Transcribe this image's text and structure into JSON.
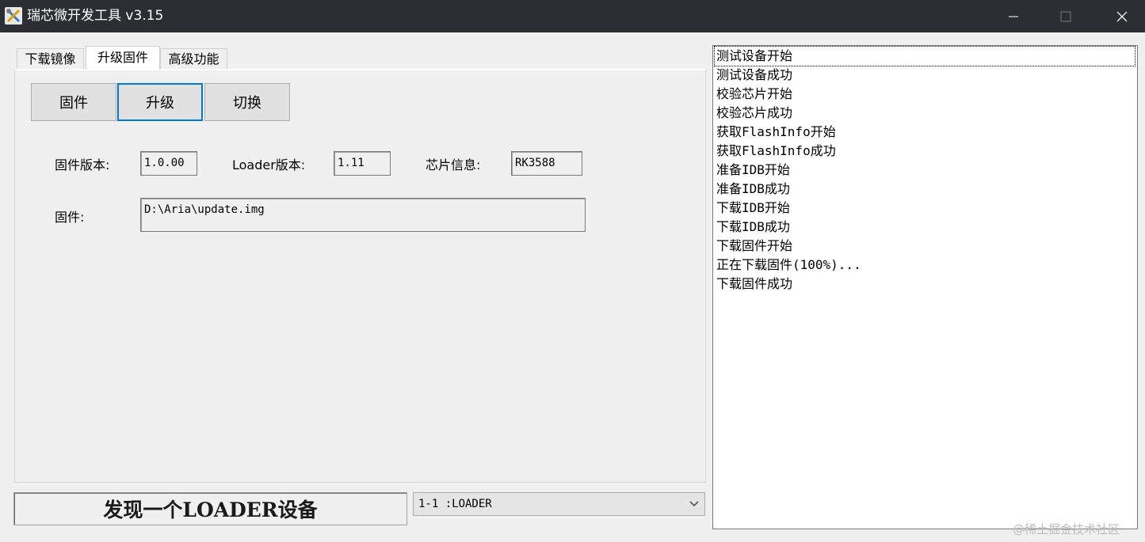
{
  "window": {
    "title": "瑞芯微开发工具 v3.15",
    "icons": {
      "app": "tools-icon",
      "minimize": "minimize-icon",
      "maximize": "maximize-icon",
      "close": "close-icon"
    }
  },
  "tabs": [
    {
      "label": "下载镜像",
      "active": false
    },
    {
      "label": "升级固件",
      "active": true
    },
    {
      "label": "高级功能",
      "active": false
    }
  ],
  "buttons": {
    "firmware": "固件",
    "upgrade": "升级",
    "switch": "切换"
  },
  "info": {
    "firmware_version_label": "固件版本:",
    "firmware_version_value": "1.0.00",
    "loader_version_label": "Loader版本:",
    "loader_version_value": "1.11",
    "chip_info_label": "芯片信息:",
    "chip_info_value": "RK3588",
    "firmware_path_label": "固件:",
    "firmware_path_value": "D:\\Aria\\update.img"
  },
  "status": {
    "message": "发现一个LOADER设备",
    "device_select_value": "1-1  :LOADER"
  },
  "log": [
    "测试设备开始",
    "测试设备成功",
    "校验芯片开始",
    "校验芯片成功",
    "获取FlashInfo开始",
    "获取FlashInfo成功",
    "准备IDB开始",
    "准备IDB成功",
    "下载IDB开始",
    "下载IDB成功",
    "下载固件开始",
    "正在下载固件(100%)...",
    "下载固件成功"
  ],
  "watermark": "@稀土掘金技术社区",
  "colors": {
    "titlebar": "#2b2f33",
    "focus_border": "#0078d7",
    "background": "#f0f0f0"
  }
}
